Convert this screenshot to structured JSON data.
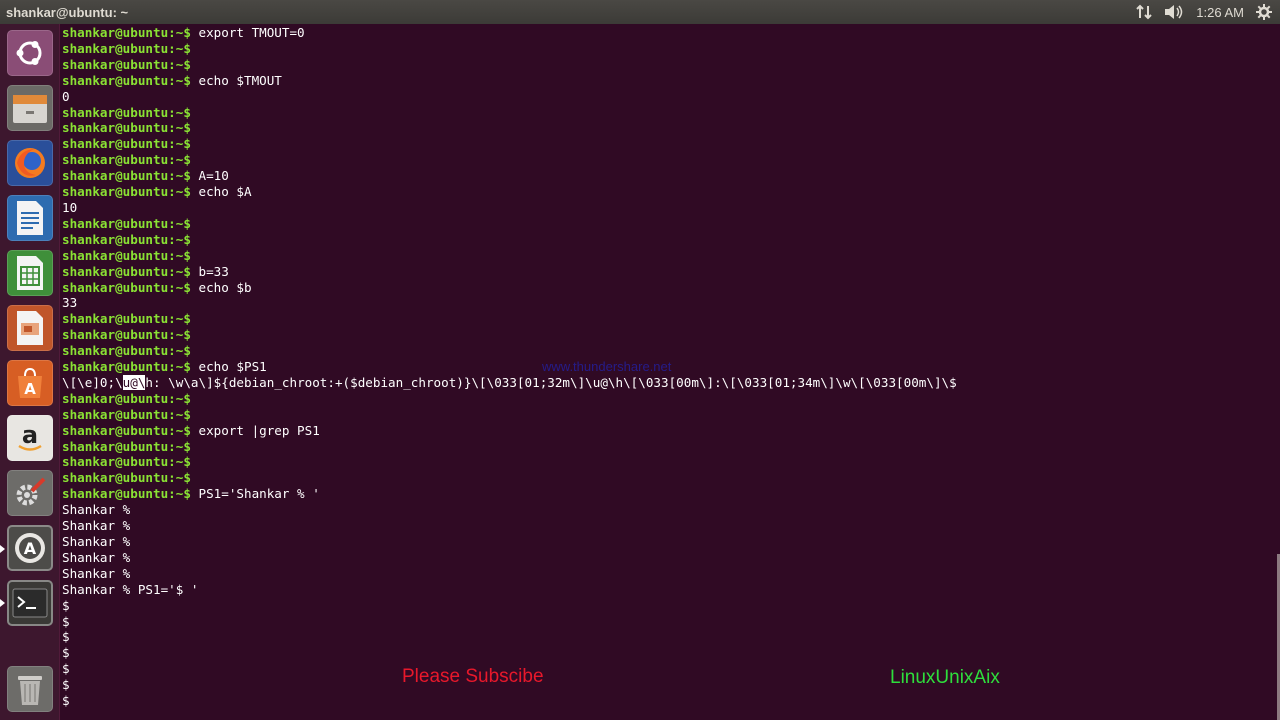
{
  "panel": {
    "title": "shankar@ubuntu: ~",
    "time": "1:26 AM",
    "icons": [
      "network-icon",
      "volume-icon",
      "gear-icon"
    ]
  },
  "launcher": {
    "items": [
      "ubuntu-dash-icon",
      "files-icon",
      "firefox-icon",
      "writer-icon",
      "calc-icon",
      "impress-icon",
      "software-center-icon",
      "amazon-icon",
      "system-settings-icon",
      "software-updater-icon",
      "terminal-icon",
      "trash-icon"
    ]
  },
  "terminal": {
    "prompt": "shankar@ubuntu:~$",
    "lines": [
      {
        "prompt": "shankar@ubuntu:~$",
        "text": " export TMOUT=0"
      },
      {
        "prompt": "shankar@ubuntu:~$",
        "text": ""
      },
      {
        "prompt": "shankar@ubuntu:~$",
        "text": ""
      },
      {
        "prompt": "shankar@ubuntu:~$",
        "text": " echo $TMOUT"
      },
      {
        "prompt": "",
        "text": "0"
      },
      {
        "prompt": "shankar@ubuntu:~$",
        "text": ""
      },
      {
        "prompt": "shankar@ubuntu:~$",
        "text": ""
      },
      {
        "prompt": "shankar@ubuntu:~$",
        "text": ""
      },
      {
        "prompt": "shankar@ubuntu:~$",
        "text": ""
      },
      {
        "prompt": "shankar@ubuntu:~$",
        "text": " A=10"
      },
      {
        "prompt": "shankar@ubuntu:~$",
        "text": " echo $A"
      },
      {
        "prompt": "",
        "text": "10"
      },
      {
        "prompt": "shankar@ubuntu:~$",
        "text": ""
      },
      {
        "prompt": "shankar@ubuntu:~$",
        "text": ""
      },
      {
        "prompt": "shankar@ubuntu:~$",
        "text": ""
      },
      {
        "prompt": "shankar@ubuntu:~$",
        "text": " b=33"
      },
      {
        "prompt": "shankar@ubuntu:~$",
        "text": " echo $b"
      },
      {
        "prompt": "",
        "text": "33"
      },
      {
        "prompt": "shankar@ubuntu:~$",
        "text": ""
      },
      {
        "prompt": "shankar@ubuntu:~$",
        "text": ""
      },
      {
        "prompt": "shankar@ubuntu:~$",
        "text": ""
      },
      {
        "prompt": "shankar@ubuntu:~$",
        "text": " echo $PS1"
      },
      {
        "prompt": "",
        "text": "\\[\\e]0;\\",
        "sel": "u@\\",
        "after": "h: \\w\\a\\]${debian_chroot:+($debian_chroot)}\\[\\033[01;32m\\]\\u@\\h\\[\\033[00m\\]:\\[\\033[01;34m\\]\\w\\[\\033[00m\\]\\$"
      },
      {
        "prompt": "shankar@ubuntu:~$",
        "text": ""
      },
      {
        "prompt": "shankar@ubuntu:~$",
        "text": ""
      },
      {
        "prompt": "shankar@ubuntu:~$",
        "text": " export |grep PS1"
      },
      {
        "prompt": "shankar@ubuntu:~$",
        "text": ""
      },
      {
        "prompt": "shankar@ubuntu:~$",
        "text": ""
      },
      {
        "prompt": "shankar@ubuntu:~$",
        "text": ""
      },
      {
        "prompt": "shankar@ubuntu:~$",
        "text": " PS1='Shankar % '"
      },
      {
        "prompt": "",
        "text": "Shankar %"
      },
      {
        "prompt": "",
        "text": "Shankar %"
      },
      {
        "prompt": "",
        "text": "Shankar %"
      },
      {
        "prompt": "",
        "text": "Shankar %"
      },
      {
        "prompt": "",
        "text": "Shankar %"
      },
      {
        "prompt": "",
        "text": "Shankar % PS1='$ '"
      },
      {
        "prompt": "",
        "text": "$"
      },
      {
        "prompt": "",
        "text": "$"
      },
      {
        "prompt": "",
        "text": "$"
      },
      {
        "prompt": "",
        "text": "$"
      },
      {
        "prompt": "",
        "text": "$"
      },
      {
        "prompt": "",
        "text": "$"
      },
      {
        "prompt": "",
        "text": "$"
      }
    ]
  },
  "watermark": "www.thundershare.net",
  "overlays": {
    "subscribe": "Please Subscibe",
    "channel": "LinuxUnixAix"
  },
  "colors": {
    "terminal_bg": "#300a24",
    "prompt_green": "#8ae234",
    "launcher_bg": "#3e182e",
    "subscribe_red": "#e8182b",
    "channel_green": "#2ede3c"
  }
}
